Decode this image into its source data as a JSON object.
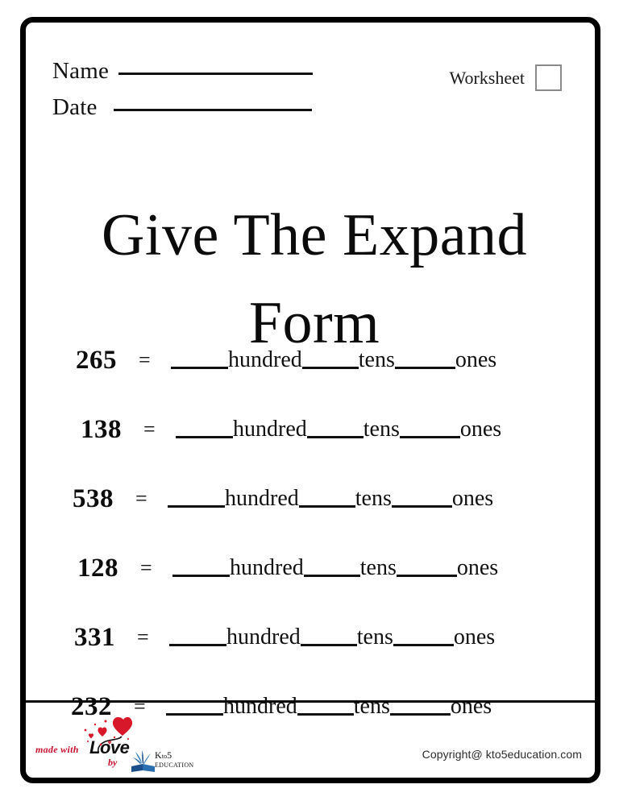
{
  "worksheet": {
    "title": "Give The Expand Form",
    "header": {
      "name_label": "Name",
      "date_label": "Date",
      "worksheet_label": "Worksheet",
      "checkbox_value": ""
    },
    "problems": {
      "equals_sign": "=",
      "place_words": {
        "hundreds": "hundred",
        "tens": "tens",
        "ones": "ones"
      },
      "rows": [
        {
          "number": "265"
        },
        {
          "number": "138"
        },
        {
          "number": "538"
        },
        {
          "number": "128"
        },
        {
          "number": "331"
        },
        {
          "number": "232"
        }
      ]
    },
    "footer": {
      "logo": {
        "made_with": "made with",
        "love": "Love",
        "by": "by",
        "brand_top": "K",
        "brand_to": "to",
        "brand_number": "5",
        "brand_bottom": "EDUCATION"
      },
      "copyright": "Copyright@ kto5education.com"
    },
    "colors": {
      "frame": "#000000",
      "text": "#111111",
      "logo_red": "#c8102e",
      "checkbox_border": "#8a8a8a",
      "page_background": "#ffffff"
    }
  }
}
